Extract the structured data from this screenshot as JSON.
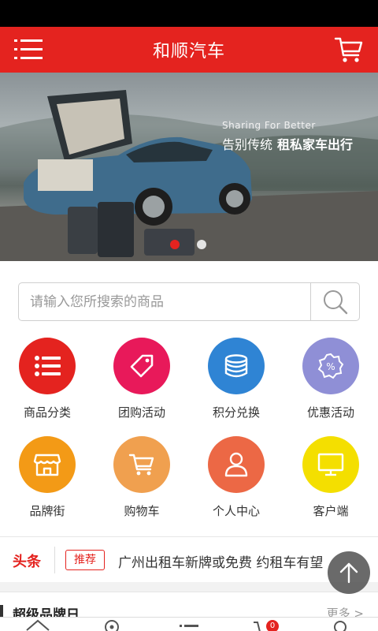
{
  "header": {
    "title": "和顺汽车",
    "menu_icon": "menu-icon",
    "cart_icon": "cart-icon"
  },
  "banner": {
    "tagline_en": "Sharing For Better",
    "tagline_cn_1": "告别传统",
    "tagline_cn_2": "租私家车出行",
    "slide_count": 2,
    "active_slide": 1
  },
  "search": {
    "placeholder": "请输入您所搜索的商品",
    "icon": "search-icon"
  },
  "categories": [
    {
      "label": "商品分类",
      "icon": "list-icon",
      "color": "#e4231f"
    },
    {
      "label": "团购活动",
      "icon": "tag-icon",
      "color": "#e8195a"
    },
    {
      "label": "积分兑换",
      "icon": "coins-icon",
      "color": "#2f84d4"
    },
    {
      "label": "优惠活动",
      "icon": "discount-icon",
      "color": "#8f8fd6"
    },
    {
      "label": "品牌街",
      "icon": "store-icon",
      "color": "#f39a16"
    },
    {
      "label": "购物车",
      "icon": "cart-icon",
      "color": "#f0a04f"
    },
    {
      "label": "个人中心",
      "icon": "user-icon",
      "color": "#ec6845"
    },
    {
      "label": "客户端",
      "icon": "monitor-icon",
      "color": "#f4df00"
    }
  ],
  "news": {
    "tag": "头条",
    "badge": "推荐",
    "headline": "广州出租车新牌或免费 约租车有望"
  },
  "section": {
    "title": "超级品牌日",
    "more": "更多 >"
  },
  "tabbar": {
    "cart_badge": "0"
  }
}
